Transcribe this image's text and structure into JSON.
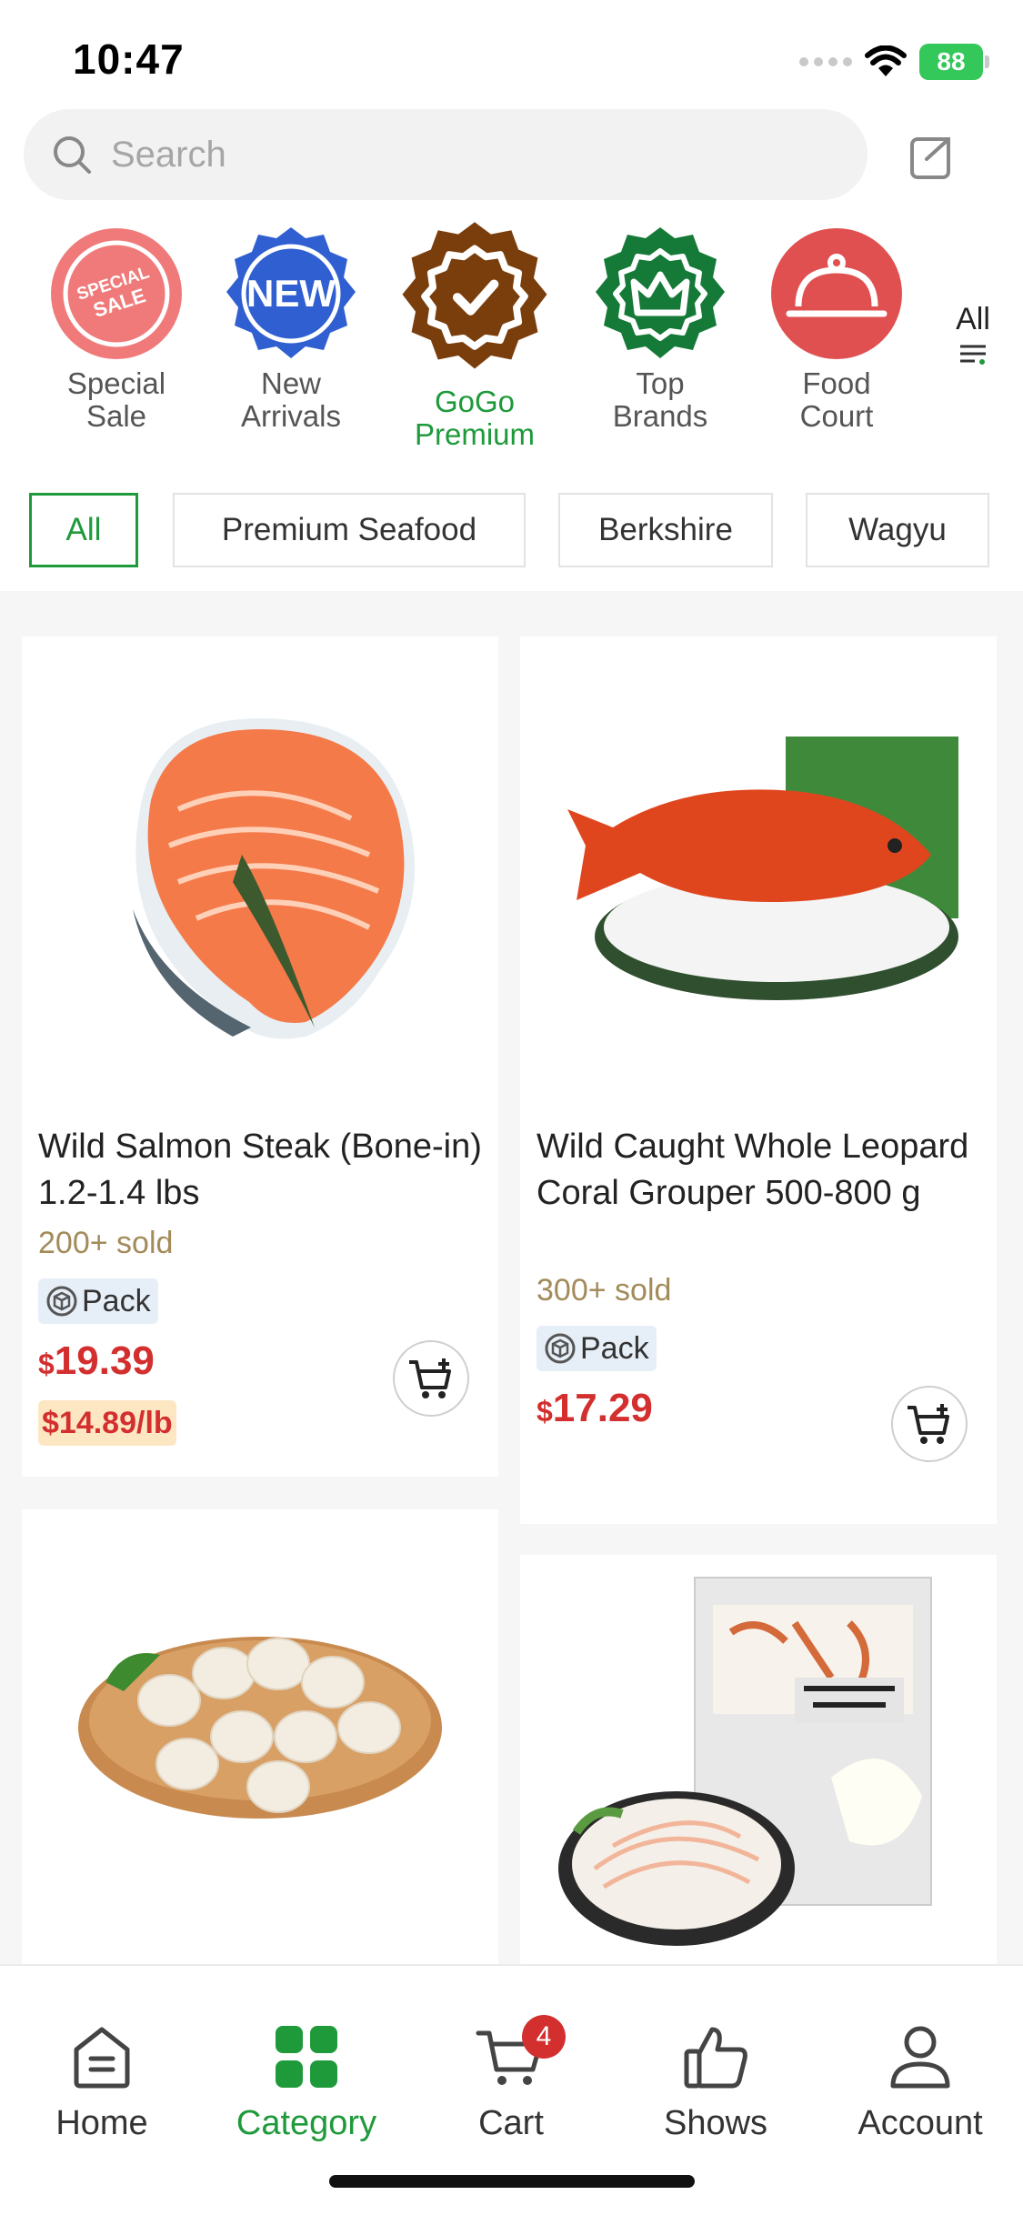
{
  "status_bar": {
    "time": "10:47",
    "battery": "88"
  },
  "search": {
    "placeholder": "Search"
  },
  "quick_categories": [
    {
      "label": "Special\nSale",
      "badge_text": "SPECIAL SALE",
      "color": "#f07a7a",
      "icon": "special-sale-badge"
    },
    {
      "label": "New\nArrivals",
      "badge_text": "NEW",
      "color": "#2f5fd0",
      "icon": "new-badge"
    },
    {
      "label": "GoGo\nPremium",
      "color": "#7a3e0c",
      "icon": "checkmark-badge",
      "active": true
    },
    {
      "label": "Top\nBrands",
      "color": "#157a37",
      "icon": "crown-badge"
    },
    {
      "label": "Food\nCourt",
      "color": "#e05050",
      "icon": "cloche-icon"
    }
  ],
  "all_button": {
    "label": "All"
  },
  "filter_chips": [
    "All",
    "Premium Seafood",
    "Berkshire",
    "Wagyu"
  ],
  "products": [
    {
      "title": "Wild Salmon Steak (Bone-in) 1.2-1.4 lbs",
      "sold": "200+ sold",
      "pack_label": "Pack",
      "currency": "$",
      "price": "19.39",
      "unit_price": "$14.89/lb",
      "image": "salmon-steak"
    },
    {
      "title": "Wild Caught Whole Leopard Coral Grouper 500-800 g",
      "sold": "300+ sold",
      "pack_label": "Pack",
      "currency": "$",
      "price": "17.29",
      "image": "coral-grouper"
    },
    {
      "image": "scallops"
    },
    {
      "image": "wild-conch-slices"
    }
  ],
  "bottom_nav": {
    "items": [
      {
        "label": "Home",
        "icon": "home-icon"
      },
      {
        "label": "Category",
        "icon": "category-icon",
        "active": true
      },
      {
        "label": "Cart",
        "icon": "cart-icon",
        "badge": "4"
      },
      {
        "label": "Shows",
        "icon": "thumbs-up-icon"
      },
      {
        "label": "Account",
        "icon": "account-icon"
      }
    ]
  },
  "colors": {
    "accent": "#1f9a3b",
    "price": "#d32f2f",
    "sold": "#a38b5a"
  }
}
